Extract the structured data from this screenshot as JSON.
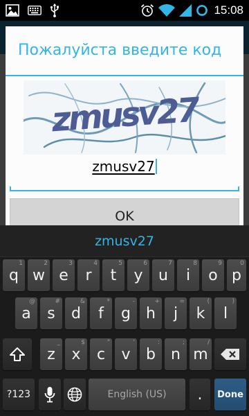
{
  "status_bar": {
    "time": "15:08",
    "icons": [
      "gallery-icon",
      "keyboard-icon",
      "usb-icon",
      "alarm-icon",
      "wifi-icon",
      "signal-icon",
      "sync-ring-icon"
    ]
  },
  "dialog": {
    "title": "Пожалуйста введите код",
    "captcha_text": "zmusv27",
    "input_value": "zmusv27",
    "ok_label": "OK"
  },
  "keyboard": {
    "suggestion": "zmusv27",
    "rows": [
      {
        "keys": [
          {
            "label": "q",
            "hint": "1"
          },
          {
            "label": "w",
            "hint": "2"
          },
          {
            "label": "e",
            "hint": "3"
          },
          {
            "label": "r",
            "hint": "4"
          },
          {
            "label": "t",
            "hint": "5"
          },
          {
            "label": "y",
            "hint": "6"
          },
          {
            "label": "u",
            "hint": "7"
          },
          {
            "label": "i",
            "hint": "8"
          },
          {
            "label": "o",
            "hint": "9"
          },
          {
            "label": "p",
            "hint": "0"
          }
        ]
      },
      {
        "keys": [
          {
            "label": "a",
            "hint": "@"
          },
          {
            "label": "s",
            "hint": "#"
          },
          {
            "label": "d",
            "hint": "&"
          },
          {
            "label": "f",
            "hint": "*"
          },
          {
            "label": "g",
            "hint": "-"
          },
          {
            "label": "h",
            "hint": "+"
          },
          {
            "label": "j",
            "hint": "="
          },
          {
            "label": "k",
            "hint": "("
          },
          {
            "label": "l",
            "hint": ")"
          }
        ]
      },
      {
        "keys": [
          {
            "label": "z",
            "hint": "_"
          },
          {
            "label": "x",
            "hint": "$"
          },
          {
            "label": "c",
            "hint": "\""
          },
          {
            "label": "v",
            "hint": "'"
          },
          {
            "label": "b",
            "hint": ":"
          },
          {
            "label": "n",
            "hint": ";"
          },
          {
            "label": "m",
            "hint": "/"
          }
        ]
      }
    ],
    "symbols_label": "?123",
    "space_label": "English (US)",
    "period_label": ".",
    "done_label": "Done",
    "accent_color": "#33b5e5",
    "done_color": "#2d5d86"
  }
}
